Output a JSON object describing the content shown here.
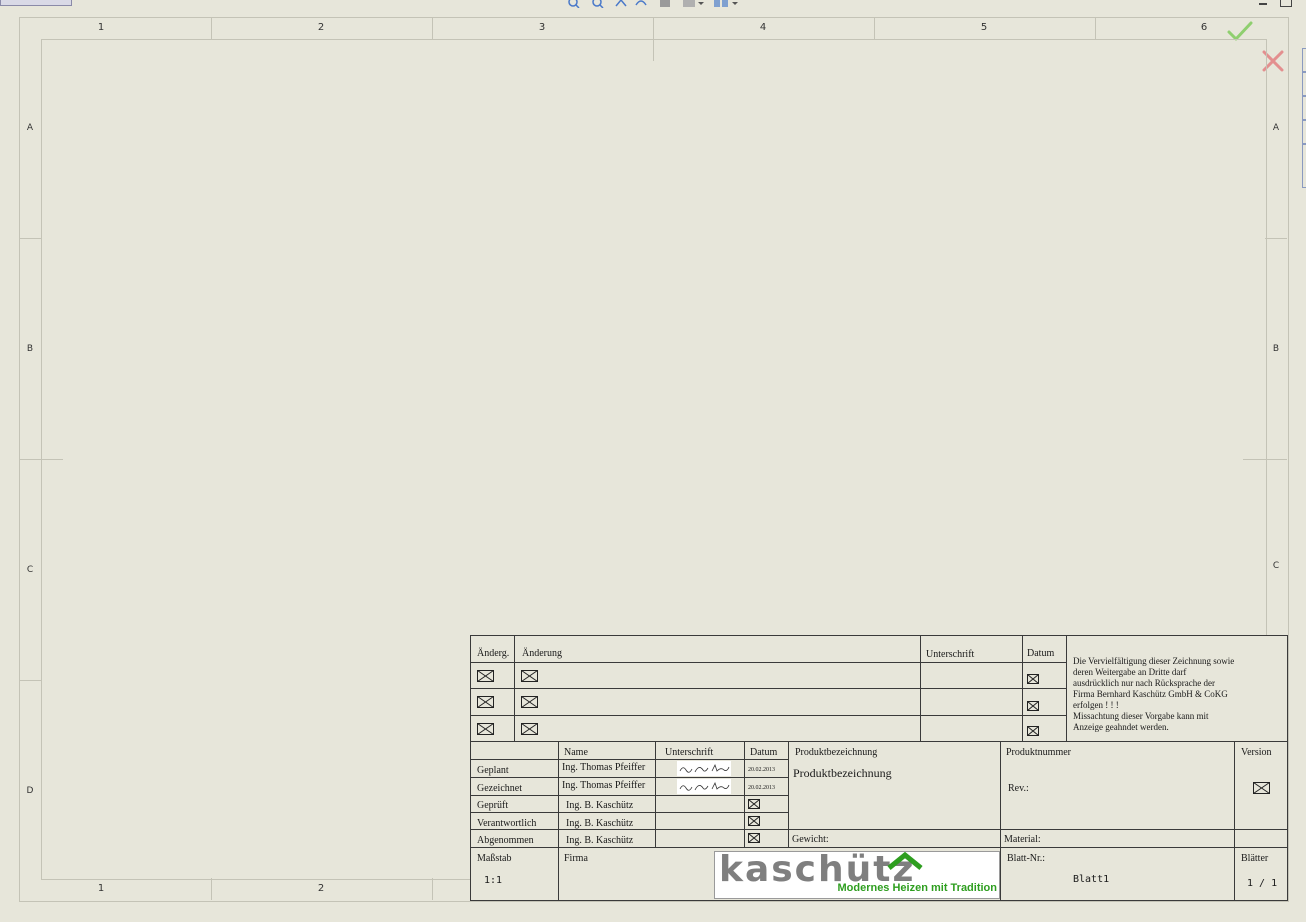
{
  "sheet": {
    "columns": [
      "1",
      "2",
      "3",
      "4",
      "5",
      "6"
    ],
    "bottom_columns": [
      "1",
      "2"
    ],
    "rows": [
      "A",
      "B",
      "C",
      "D"
    ]
  },
  "revision_table": {
    "headers": {
      "change_no": "Änderg.",
      "change": "Änderung",
      "signature": "Unterschrift",
      "date": "Datum"
    },
    "rows": 3
  },
  "notice": {
    "lines": [
      "Die Vervielfältigung dieser Zeichnung sowie",
      "deren Weitergabe an Dritte darf",
      "ausdrücklich nur nach Rücksprache der",
      "Firma Bernhard Kaschütz GmbH & CoKG",
      "erfolgen ! ! !",
      "Missachtung dieser Vorgabe kann mit",
      "Anzeige geahndet werden."
    ]
  },
  "approval": {
    "headers": {
      "name": "Name",
      "signature": "Unterschrift",
      "date": "Datum"
    },
    "rows": [
      {
        "role": "Geplant",
        "name": "Ing. Thomas Pfeiffer",
        "date": "20.02.2013"
      },
      {
        "role": "Gezeichnet",
        "name": "Ing. Thomas Pfeiffer",
        "date": "20.02.2013"
      },
      {
        "role": "Geprüft",
        "name": "Ing. B. Kaschütz"
      },
      {
        "role": "Verantwortlich",
        "name": "Ing. B. Kaschütz"
      },
      {
        "role": "Abgenommen",
        "name": "Ing. B. Kaschütz"
      }
    ]
  },
  "product": {
    "label": "Produktbezeichnung",
    "value": "Produktbezeichnung",
    "number_label": "Produktnummer",
    "rev_label": "Rev.:",
    "version_label": "Version",
    "weight_label": "Gewicht:",
    "material_label": "Material:"
  },
  "footer": {
    "scale_label": "Maßstab",
    "scale_value": "1:1",
    "company_label": "Firma",
    "sheet_no_label": "Blatt-Nr.:",
    "sheet_no_value": "Blatt1",
    "sheets_label": "Blätter",
    "sheets_value": "1 / 1"
  },
  "logo": {
    "wordmark": "kaschütz",
    "slogan": "Modernes Heizen mit Tradition",
    "color_gray": "#7f7f7f",
    "color_green": "#2e9e1f"
  },
  "colors": {
    "background": "#e7e6da",
    "confirm": "#8fcf6f",
    "cancel": "#e38f8f"
  },
  "icons": [
    "zoom-in-icon",
    "zoom-out-icon",
    "pan-icon",
    "rotate-icon",
    "hand-icon",
    "view-icon",
    "display-icon",
    "confirm-check-icon",
    "cancel-x-icon"
  ]
}
